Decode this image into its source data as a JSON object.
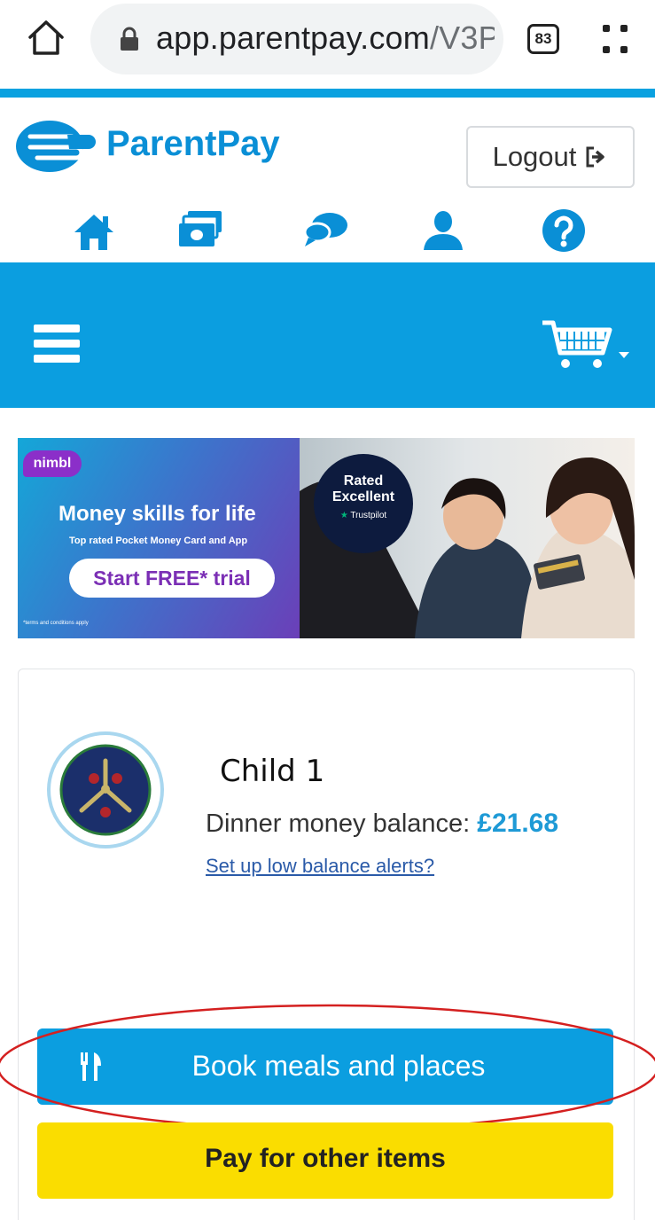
{
  "browser": {
    "url_host": "app.parentpay.com",
    "url_path": "/V3Pa",
    "tab_count": "83",
    "icons": [
      "home-icon",
      "lock-icon",
      "tabs-icon",
      "menu-icon"
    ]
  },
  "header": {
    "brand": "ParentPay",
    "logout_label": "Logout",
    "nav_icons": [
      "home-icon",
      "payments-icon",
      "messages-icon",
      "profile-icon",
      "help-icon"
    ],
    "accent_color": "#0b9ee0"
  },
  "navbar": {
    "icons": [
      "hamburger-menu-icon",
      "shopping-cart-icon",
      "caret-down-icon"
    ]
  },
  "banner": {
    "brand": "nimbl",
    "title": "Money skills for life",
    "subtitle": "Top rated Pocket Money Card and App",
    "cta": "Start FREE* trial",
    "fine_print": "*terms and conditions apply",
    "rating_line1": "Rated",
    "rating_line2": "Excellent",
    "rating_source": "Trustpilot"
  },
  "child": {
    "name": "Child 1",
    "balance_label": "Dinner money balance:",
    "balance_value": "£21.68",
    "alerts_link": "Set up low balance alerts?"
  },
  "actions": {
    "book_label": "Book meals and places",
    "book_color": "#0b9ee0",
    "pay_label": "Pay for other items",
    "pay_color": "#fadd00"
  }
}
